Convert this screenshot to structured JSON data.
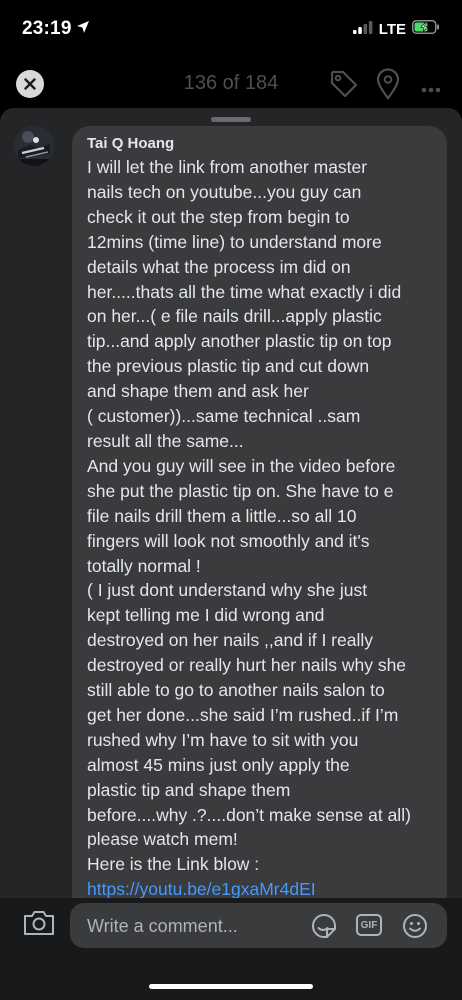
{
  "status_bar": {
    "time": "23:19",
    "network": "LTE"
  },
  "header": {
    "counter": "136 of 184"
  },
  "comment": {
    "author": "Tai Q Hoang",
    "lines": [
      "I will let the link from another master",
      "nails tech on youtube...you guy can",
      "check it out the step from begin to",
      "12mins (time line) to understand more",
      "details what the process im did on",
      "her.....thats all the time what exactly i did",
      "on her...( e file nails drill...apply plastic",
      "tip...and apply another plastic tip on top",
      "the previous plastic tip and cut down",
      "and shape them and ask her",
      "( customer))...same technical ..sam",
      "result all the same...",
      "And you guy will see in the video before",
      "she put the plastic tip on. She have to e",
      "file nails drill them a little...so all 10",
      "fingers will look not smoothly and it's",
      "totally normal !",
      "( I just dont understand why she just",
      "kept telling me I did wrong and",
      "destroyed on her nails ,,and if I really",
      "destroyed or really hurt her nails why she",
      "still able to go to another nails salon to",
      "get her done...she said I’m rushed..if I’m",
      "rushed why I’m have to sit with you",
      "almost 45 mins just only apply the",
      "plastic tip and shape them",
      "before....why .?....don’t make sense at all)",
      "please watch mem!",
      "Here is the Link blow :"
    ],
    "link": "https://youtu.be/e1gxaMr4dEI"
  },
  "composer": {
    "placeholder": "Write a comment...",
    "gif_label": "GIF"
  },
  "colors": {
    "link": "#4599ff",
    "bubble": "#3a3b3c",
    "sheet": "#242526",
    "battery": "#4cd964"
  }
}
